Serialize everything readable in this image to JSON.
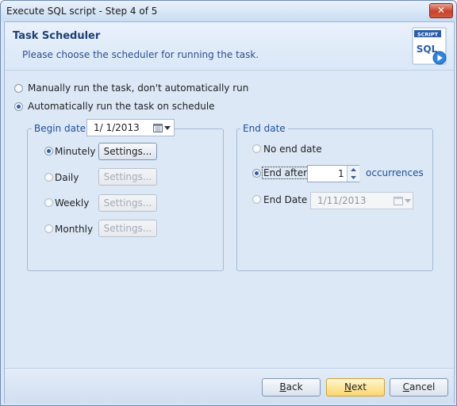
{
  "window": {
    "title": "Execute SQL script - Step 4 of 5",
    "close_glyph": "✕"
  },
  "header": {
    "title": "Task Scheduler",
    "subtitle": "Please choose the scheduler for running the task.",
    "logo_top": "SCRIPT",
    "logo_main": "SQL"
  },
  "mode": {
    "manual": "Manually run the task, don't automatically run",
    "automatic": "Automatically run the task on schedule",
    "selected": "automatic"
  },
  "begin": {
    "legend": "Begin date",
    "date": "1/  1/2013",
    "frequency": [
      {
        "label": "Minutely",
        "button": "Settings...",
        "selected": true,
        "enabled": true
      },
      {
        "label": "Daily",
        "button": "Settings...",
        "selected": false,
        "enabled": false
      },
      {
        "label": "Weekly",
        "button": "Settings...",
        "selected": false,
        "enabled": false
      },
      {
        "label": "Monthly",
        "button": "Settings...",
        "selected": false,
        "enabled": false
      }
    ]
  },
  "end": {
    "legend": "End date",
    "no_end": "No end date",
    "end_after": "End after",
    "occurrences_value": "1",
    "occurrences_label": "occurrences",
    "end_date_label": "End Date",
    "end_date_value": "1/11/2013",
    "selected": "end_after"
  },
  "footer": {
    "back": {
      "underlined": "B",
      "rest": "ack"
    },
    "next": {
      "underlined": "N",
      "rest": "ext"
    },
    "cancel": {
      "underlined": "C",
      "rest": "ancel"
    }
  },
  "colors": {
    "accent": "#1f4f98",
    "header_title": "#1f3f74",
    "next_button": "#fbd66e"
  },
  "icons": [
    "calendar-icon",
    "chevron-down-icon",
    "spin-up-icon",
    "spin-down-icon",
    "close-icon",
    "sql-script-logo-icon"
  ]
}
